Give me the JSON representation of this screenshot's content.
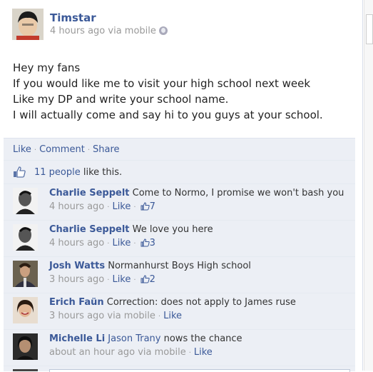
{
  "post": {
    "author": "Timstar",
    "meta": "4 hours ago via mobile",
    "lines": [
      "Hey my fans",
      "If you would like me to visit your high school next week",
      "Like my DP and write your school name.",
      "I will actually come and say hi to you guys at your school."
    ]
  },
  "actions": {
    "like": "Like",
    "comment": "Comment",
    "share": "Share",
    "separator": "·"
  },
  "likes": {
    "people": "11 people",
    "suffix": " like this."
  },
  "comments": [
    {
      "name": "Charlie Seppelt",
      "text": " Come to Normo, I promise we won't bash you",
      "time": "4 hours ago",
      "via": "",
      "like": "Like",
      "count": "7"
    },
    {
      "name": "Charlie Seppelt",
      "text": " We love you here",
      "time": "4 hours ago",
      "via": "",
      "like": "Like",
      "count": "3"
    },
    {
      "name": "Josh Watts",
      "text": " Normanhurst Boys High school",
      "time": "3 hours ago",
      "via": "",
      "like": "Like",
      "count": "2"
    },
    {
      "name": "Erich Faün",
      "text": " Correction: does not apply to James ruse",
      "time": "3 hours ago",
      "via": " via mobile",
      "like": "Like",
      "count": ""
    },
    {
      "name": "Michelle Li",
      "mention": " Jason Trany",
      "text": " nows the chance",
      "time": "about an hour ago",
      "via": " via mobile",
      "like": "Like",
      "count": ""
    }
  ],
  "colors": {
    "link": "#3b5998",
    "panel": "#eceff5",
    "meta": "#999999"
  },
  "icons": [
    "globe-icon",
    "thumbs-up-icon"
  ]
}
